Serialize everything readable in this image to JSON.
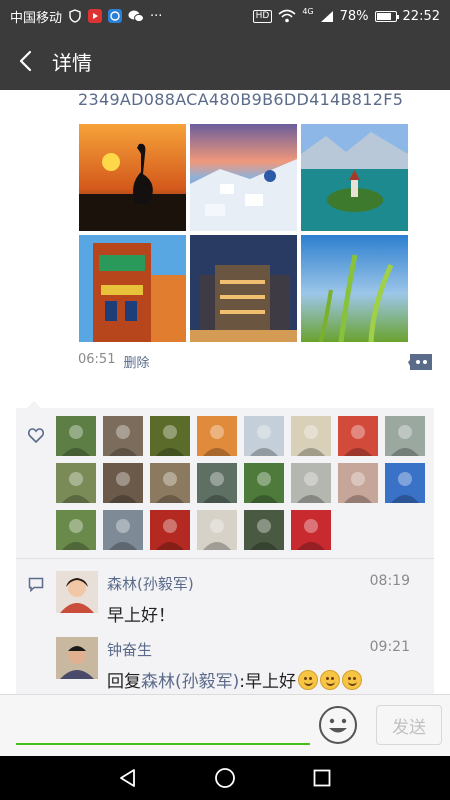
{
  "status_bar": {
    "carrier": "中国移动",
    "network": "4G",
    "hd": "HD",
    "battery_percent": "78%",
    "battery_level": 0.78,
    "time": "22:52",
    "more": "···"
  },
  "header": {
    "title": "详情",
    "back_icon": "back-arrow-icon"
  },
  "post": {
    "hash_text": "2349AD088ACA480B9B6DD414B812F5",
    "photos": [
      {
        "name": "heron-sunset-photo",
        "colors": [
          "#f08a2c",
          "#1a120b"
        ]
      },
      {
        "name": "santorini-photo",
        "colors": [
          "#e88b6a",
          "#d8e4f2"
        ]
      },
      {
        "name": "lake-island-photo",
        "colors": [
          "#7aa7d8",
          "#1d8a8f"
        ]
      },
      {
        "name": "colorful-building-photo",
        "colors": [
          "#58a7e3",
          "#b8461c"
        ]
      },
      {
        "name": "city-night-photo",
        "colors": [
          "#2a3b63",
          "#d49b55"
        ]
      },
      {
        "name": "wheat-field-photo",
        "colors": [
          "#2e7fd0",
          "#88c23a"
        ]
      }
    ],
    "time": "06:51",
    "delete_label": "删除",
    "more_icon": "comment-more-icon"
  },
  "likes": {
    "icon": "heart-icon",
    "avatar_colors": [
      "#5d7e45",
      "#7c6c5c",
      "#5a6b2a",
      "#e08a3c",
      "#c4cfd9",
      "#d8d0b8",
      "#d24a3a",
      "#9aa8a0",
      "#7a8b58",
      "#6b5a4a",
      "#8c7a60",
      "#5e6f64",
      "#4e7a3c",
      "#b4b6b0",
      "#c7a69a",
      "#3a72c8",
      "#6a8a4c",
      "#7e8a96",
      "#b42a22",
      "#d6d2c8",
      "#4a5a42",
      "#c82a30"
    ]
  },
  "comments": {
    "icon": "comment-bubble-icon",
    "items": [
      {
        "author": "森林(孙毅军)",
        "time": "08:19",
        "text": "早上好！",
        "avatar_color": "#c94d3a"
      },
      {
        "author": "钟奋生",
        "time": "09:21",
        "reply_prefix": "回复",
        "reply_to": "森林(孙毅军)",
        "reply_text": ":早上好",
        "emoji_count": 3,
        "avatar_color": "#4a4a6a"
      }
    ]
  },
  "input": {
    "placeholder": "",
    "emoji_icon": "emoji-smile-icon",
    "send_label": "发送"
  },
  "nav": {
    "back": "nav-back-icon",
    "home": "nav-home-icon",
    "recents": "nav-recents-icon"
  },
  "colors": {
    "bar_bg": "#3b3b3b",
    "link": "#5b6b8a",
    "accent_green": "#45c01a",
    "panel_bg": "#f3f3f5"
  }
}
